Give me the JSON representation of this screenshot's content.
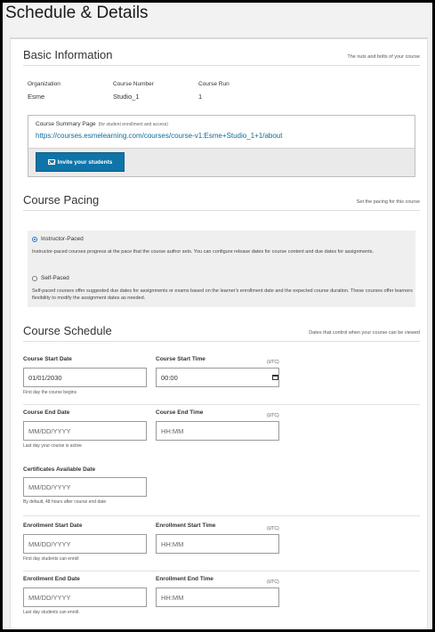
{
  "page": {
    "title": "Schedule & Details"
  },
  "basic": {
    "title": "Basic Information",
    "subtitle": "The nuts and bolts of your course",
    "organization_label": "Organization",
    "organization_value": "Esme",
    "course_number_label": "Course Number",
    "course_number_value": "Studio_1",
    "course_run_label": "Course Run",
    "course_run_value": "1",
    "summary_label": "Course Summary Page",
    "summary_hint": "(for student enrollment and access)",
    "summary_url": "https://courses.esmelearning.com/courses/course-v1:Esme+Studio_1+1/about",
    "invite_label": "Invite your students"
  },
  "pacing": {
    "title": "Course Pacing",
    "subtitle": "Set the pacing for this course",
    "options": [
      {
        "label": "Instructor-Paced",
        "selected": true,
        "description": "Instructor-paced courses progress at the pace that the course author sets. You can configure release dates for course content and due dates for assignments."
      },
      {
        "label": "Self-Paced",
        "selected": false,
        "description": "Self-paced courses offer suggested due dates for assignments or exams based on the learner's enrollment date and the expected course duration. These courses offer learners flexibility to modify the assignment dates as needed."
      }
    ]
  },
  "schedule": {
    "title": "Course Schedule",
    "subtitle": "Dates that control when your course can be viewed",
    "utc_label": "(UTC)",
    "date_placeholder": "MM/DD/YYYY",
    "time_placeholder": "HH:MM",
    "course_start_date_label": "Course Start Date",
    "course_start_date_value": "01/01/2030",
    "course_start_date_help": "First day the course begins",
    "course_start_time_label": "Course Start Time",
    "course_start_time_value": "00:00",
    "course_end_date_label": "Course End Date",
    "course_end_date_help": "Last day your course is active",
    "course_end_time_label": "Course End Time",
    "certificates_label": "Certificates Available Date",
    "certificates_help": "By default, 48 hours after course end date",
    "enroll_start_date_label": "Enrollment Start Date",
    "enroll_start_date_help": "First day students can enroll",
    "enroll_start_time_label": "Enrollment Start Time",
    "enroll_end_date_label": "Enrollment End Date",
    "enroll_end_date_help": "Last day students can enroll.",
    "enroll_end_time_label": "Enrollment End Time"
  }
}
